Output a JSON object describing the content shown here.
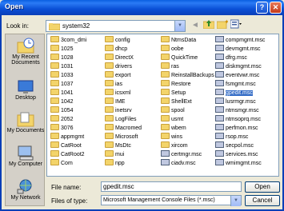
{
  "window": {
    "title": "Open"
  },
  "toolbar": {
    "look_in_label": "Look in:",
    "look_in_value": "system32"
  },
  "places": [
    {
      "label": "My Recent Documents"
    },
    {
      "label": "Desktop"
    },
    {
      "label": "My Documents"
    },
    {
      "label": "My Computer"
    },
    {
      "label": "My Network"
    }
  ],
  "files": {
    "col1": [
      "3com_dmi",
      "1025",
      "1028",
      "1031",
      "1033",
      "1037",
      "1041",
      "1042",
      "1054",
      "2052",
      "3076",
      "appmgmt",
      "CatRoot",
      "CatRoot2",
      "Com"
    ],
    "col2": [
      "config",
      "dhcp",
      "DirectX",
      "drivers",
      "export",
      "ias",
      "icsxml",
      "IME",
      "inetsrv",
      "LogFiles",
      "Macromed",
      "Microsoft",
      "MsDtc",
      "mui",
      "npp"
    ],
    "col3": [
      "NtmsData",
      "oobe",
      "QuickTime",
      "ras",
      "ReinstallBackups",
      "Restore",
      "Setup",
      "ShellExt",
      "spool",
      "usmt",
      "wbem",
      "wins",
      "xircom",
      "certmgr.msc",
      "ciadv.msc"
    ],
    "col4": [
      "compmgmt.msc",
      "devmgmt.msc",
      "dfrg.msc",
      "diskmgmt.msc",
      "eventvwr.msc",
      "fsmgmt.msc",
      "gpedit.msc",
      "lusrmgr.msc",
      "ntmsmgr.msc",
      "ntmsoprq.msc",
      "perfmon.msc",
      "rsop.msc",
      "secpol.msc",
      "services.msc",
      "wmimgmt.msc"
    ]
  },
  "selected_file": "gpedit.msc",
  "filename": {
    "label": "File name:",
    "value": "gpedit.msc"
  },
  "filetype": {
    "label": "Files of type:",
    "value": "Microsoft Management Console Files (*.msc)"
  },
  "buttons": {
    "open": "Open",
    "cancel": "Cancel"
  }
}
